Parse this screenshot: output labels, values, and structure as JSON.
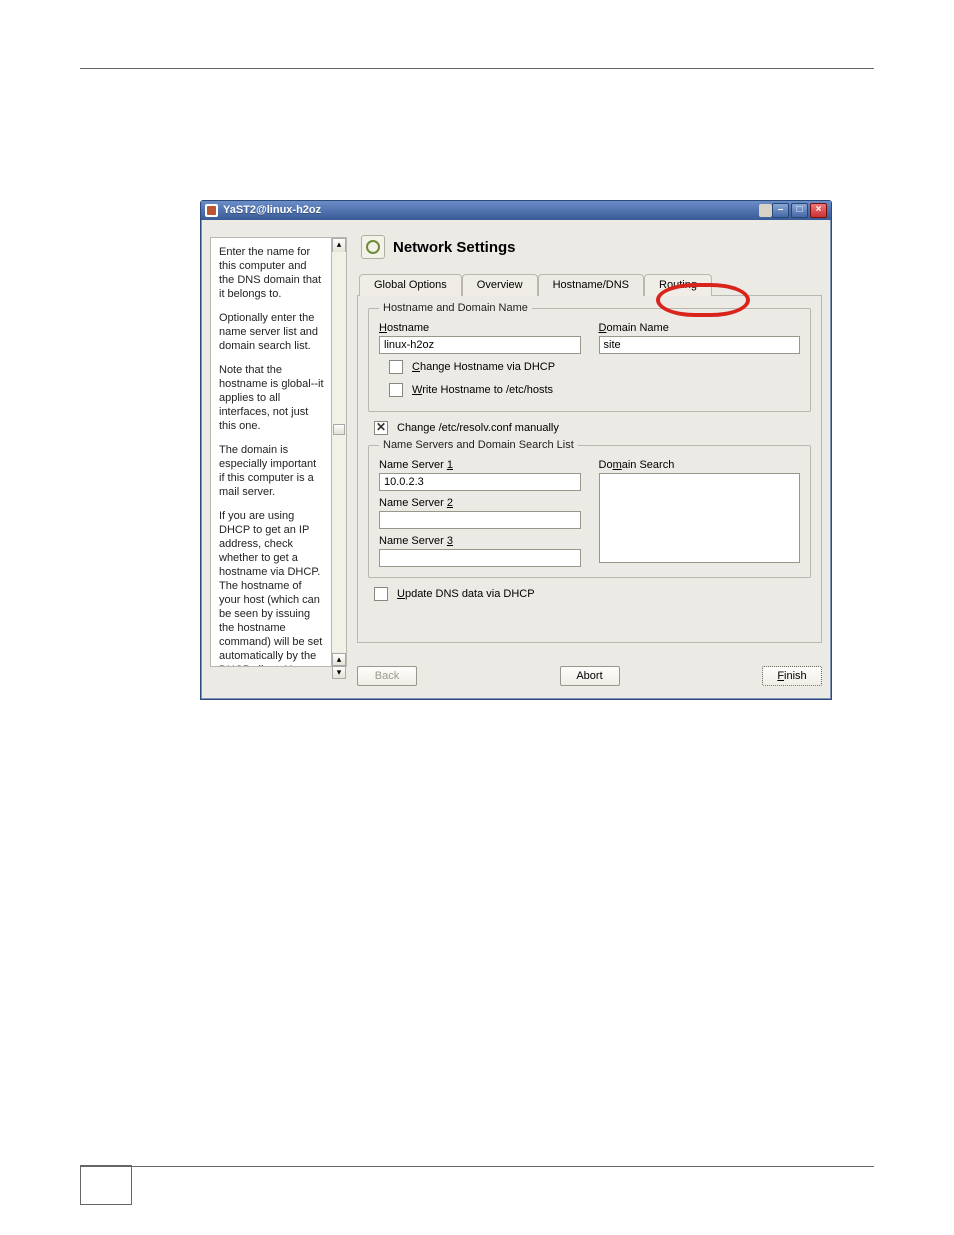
{
  "window": {
    "title": "YaST2@linux-h2oz"
  },
  "main": {
    "title": "Network Settings"
  },
  "tabs": [
    "Global Options",
    "Overview",
    "Hostname/DNS",
    "Routing"
  ],
  "groups": {
    "hostname_domain": "Hostname and Domain Name",
    "nameservers": "Name Servers and Domain Search List"
  },
  "labels": {
    "hostname": "ostname",
    "domain_name": "omain Name",
    "domain_search": "ain Search"
  },
  "checkboxes": {
    "change_hostname_dhcp": "hange Hostname via DHCP",
    "write_hostname_hosts": "rite Hostname to /etc/hosts",
    "resolv_manual": "Change /etc/resolv.conf manually",
    "update_dns_dhcp": "pdate DNS data via DHCP"
  },
  "values": {
    "hostname": "linux-h2oz",
    "domain_name": "site",
    "ns1": "10.0.2.3",
    "ns2": "",
    "ns3": ""
  },
  "buttons": {
    "back": "Back",
    "abort": "Abort",
    "finish": "inish"
  },
  "help": {
    "p1": "Enter the name for this computer and the DNS domain that it belongs to.",
    "p2": "Optionally enter the name server list and domain search list.",
    "p3": "Note that the hostname is global--it applies to all interfaces, not just this one.",
    "p4": "The domain is especially important if this computer is a mail server.",
    "p5": "If you are using DHCP to get an IP address, check whether to get a hostname via DHCP. The hostname of your host (which can be seen by issuing the hostname command) will be set automatically by the DHCP client. You may want to disable this option if you connect to different networks"
  }
}
